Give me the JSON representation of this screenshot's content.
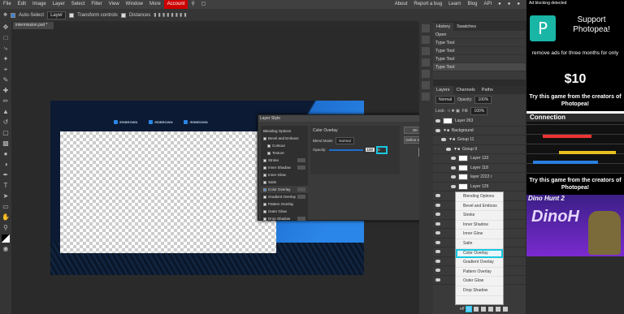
{
  "menu": {
    "items": [
      "File",
      "Edit",
      "Image",
      "Layer",
      "Select",
      "Filter",
      "View",
      "Window",
      "More"
    ],
    "account": "Account",
    "right": [
      "About",
      "Report a bug",
      "Learn",
      "Blog",
      "API"
    ]
  },
  "options": {
    "auto_select": "Auto-Select",
    "layer_select": "Layer",
    "transform_controls": "Transform controls",
    "distances": "Distances"
  },
  "document_tab": "intermission.psd *",
  "canvas": {
    "social_labels": [
      "/RSBROWN",
      "/RSBROWN",
      "/RSBROWN"
    ]
  },
  "layer_style_dialog": {
    "title": "Layer Style",
    "left_items": [
      {
        "label": "Blending Options",
        "checked": false,
        "header": true
      },
      {
        "label": "Bevel and Emboss",
        "checked": false
      },
      {
        "label": "Contour",
        "checked": false,
        "indent": true
      },
      {
        "label": "Texture",
        "checked": false,
        "indent": true
      },
      {
        "label": "Stroke",
        "checked": false
      },
      {
        "label": "Inner Shadow",
        "checked": false
      },
      {
        "label": "Inner Glow",
        "checked": false
      },
      {
        "label": "Satin",
        "checked": false
      },
      {
        "label": "Color Overlay",
        "checked": true
      },
      {
        "label": "Gradient Overlay",
        "checked": false
      },
      {
        "label": "Pattern Overlay",
        "checked": false
      },
      {
        "label": "Outer Glow",
        "checked": false
      },
      {
        "label": "Drop Shadow",
        "checked": false
      }
    ],
    "section_title": "Color Overlay",
    "blend_mode_label": "Blend Mode:",
    "blend_mode_value": "Normal",
    "opacity_label": "Opacity:",
    "opacity_value": "100",
    "ok_label": "OK",
    "define_new_label": "Define New",
    "overlay_color": "#6a14b8"
  },
  "history": {
    "tabs": [
      "History",
      "Swatches"
    ],
    "items": [
      "Open",
      "Type Tool",
      "Type Tool",
      "Type Tool",
      "Type Tool"
    ]
  },
  "layers_panel": {
    "tabs": [
      "Layers",
      "Channels",
      "Paths"
    ],
    "blend": "Normal",
    "opacity_label": "Opacity:",
    "opacity": "100%",
    "lock_label": "Lock:",
    "fill_label": "Fill:",
    "fill": "100%",
    "rows": [
      "Layer 263",
      "Background",
      "Group 11",
      "Group 9",
      "Layer 133",
      "Layer 118",
      "layer 2222 r",
      "Layer 129"
    ]
  },
  "context_menu": {
    "items": [
      "Blending Options",
      "Bevel and Emboss",
      "Stroke",
      "Inner Shadow",
      "Inner Glow",
      "Satin",
      "Color Overlay",
      "Gradient Overlay",
      "Pattern Overlay",
      "Outer Glow",
      "Drop Shadow"
    ],
    "highlighted": "Color Overlay"
  },
  "bottom_label": "eff",
  "ads": {
    "notice": "Ad blocking detected",
    "ad1_title": "Support Photopea!",
    "ad1_body": "remove ads for three months for only",
    "ad1_price": "$10",
    "ad2_msg": "Try this game from the creators of Photopea!",
    "ad2_game": "Connection",
    "ad3_msg": "Try this game from the creators of Photopea!",
    "ad3_game": "Dino Hunt 2",
    "ad3_big": "DinoH"
  }
}
